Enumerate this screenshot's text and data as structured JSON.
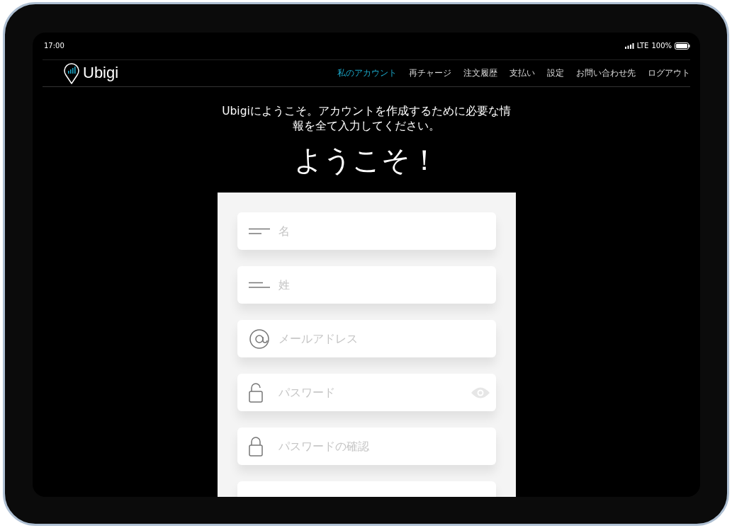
{
  "status_bar": {
    "time": "17:00",
    "network": "LTE",
    "battery": "100%"
  },
  "nav": {
    "logo": "Ubigi",
    "items": [
      {
        "label": "私のアカウント",
        "selected": true
      },
      {
        "label": "再チャージ",
        "selected": false
      },
      {
        "label": "注文履歴",
        "selected": false
      },
      {
        "label": "支払い",
        "selected": false
      },
      {
        "label": "設定",
        "selected": false
      },
      {
        "label": "お問い合わせ先",
        "selected": false
      },
      {
        "label": "ログアウト",
        "selected": false
      }
    ]
  },
  "intro": "Ubigiにようこそ。アカウントを作成するために必要な情報を全て入力してください。",
  "title": "ようこそ！",
  "form": {
    "fields": [
      {
        "kind": "lines",
        "placeholder": "名",
        "reveal_toggle": false
      },
      {
        "kind": "lines-even",
        "placeholder": "姓",
        "reveal_toggle": false
      },
      {
        "kind": "at",
        "placeholder": "メールアドレス",
        "reveal_toggle": false
      },
      {
        "kind": "unlock",
        "placeholder": "パスワード",
        "reveal_toggle": true
      },
      {
        "kind": "lock",
        "placeholder": "パスワードの確認",
        "reveal_toggle": false
      }
    ]
  }
}
